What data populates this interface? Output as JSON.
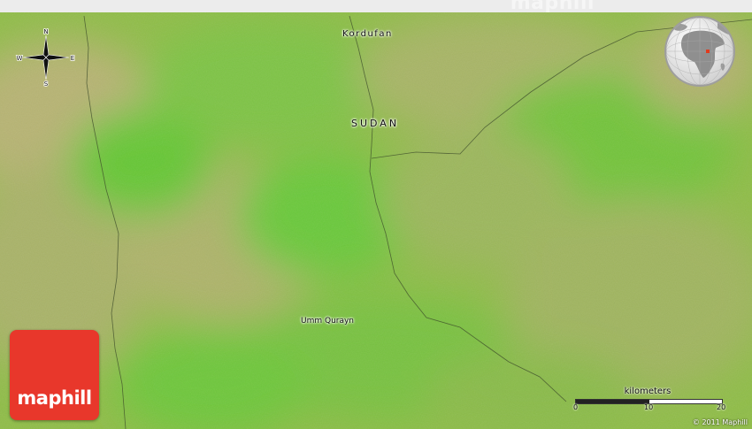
{
  "watermark": "maphill",
  "labels": {
    "region": "Kordufan",
    "country": "SUDAN",
    "town": "Umm Qurayn"
  },
  "compass": {
    "n": "N",
    "s": "S",
    "e": "E",
    "w": "W"
  },
  "logo": {
    "text": "maphill",
    "color": "#e8372b"
  },
  "scale": {
    "title": "kilometers",
    "ticks": [
      "0",
      "10",
      "20"
    ]
  },
  "copyright": "© 2011 Maphill",
  "colors": {
    "terrain_green": "#6cc63b",
    "terrain_khaki": "#a4b25c",
    "marker": "#e03b1e"
  },
  "icons": [
    "compass-rose-icon",
    "globe-locator-icon",
    "maphill-logo"
  ]
}
